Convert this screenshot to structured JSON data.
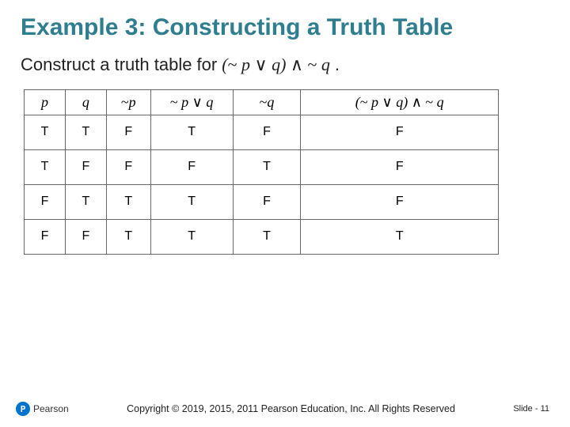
{
  "title": "Example 3: Constructing a Truth Table",
  "prompt_lead": "Construct a truth table for",
  "prompt_expr_html": "(<span class='tilde'>~</span> <span>p</span> <span class='op'>∨</span> <span>q</span>) <span class='op'>∧</span> <span class='tilde'>~</span> <span>q</span>",
  "prompt_trail": ".",
  "headers": {
    "p": "p",
    "q": "q",
    "np_html": "<span class='tilde'>~</span>p",
    "npq_html": "<span class='tilde'>~</span> p <span class='op'>∨</span> q",
    "nq_html": "<span class='tilde'>~</span>q",
    "fin_html": "(<span class='tilde'>~</span> p <span class='op'>∨</span> q) <span class='op'>∧</span> <span class='tilde'>~</span> q"
  },
  "rows": [
    {
      "p": "T",
      "q": "T",
      "np": "F",
      "npq": "T",
      "nq": "F",
      "fin": "F"
    },
    {
      "p": "T",
      "q": "F",
      "np": "F",
      "npq": "F",
      "nq": "T",
      "fin": "F"
    },
    {
      "p": "F",
      "q": "T",
      "np": "T",
      "npq": "T",
      "nq": "F",
      "fin": "F"
    },
    {
      "p": "F",
      "q": "F",
      "np": "T",
      "npq": "T",
      "nq": "T",
      "fin": "T"
    }
  ],
  "chart_data": {
    "type": "table",
    "columns": [
      "p",
      "q",
      "~p",
      "~p ∨ q",
      "~q",
      "(~p ∨ q) ∧ ~q"
    ],
    "rows": [
      [
        "T",
        "T",
        "F",
        "T",
        "F",
        "F"
      ],
      [
        "T",
        "F",
        "F",
        "F",
        "T",
        "F"
      ],
      [
        "F",
        "T",
        "T",
        "T",
        "F",
        "F"
      ],
      [
        "F",
        "F",
        "T",
        "T",
        "T",
        "T"
      ]
    ]
  },
  "footer": {
    "brand": "Pearson",
    "copyright": "Copyright © 2019, 2015, 2011 Pearson Education, Inc. All Rights Reserved",
    "slide_label": "Slide -",
    "slide_number": "11"
  }
}
